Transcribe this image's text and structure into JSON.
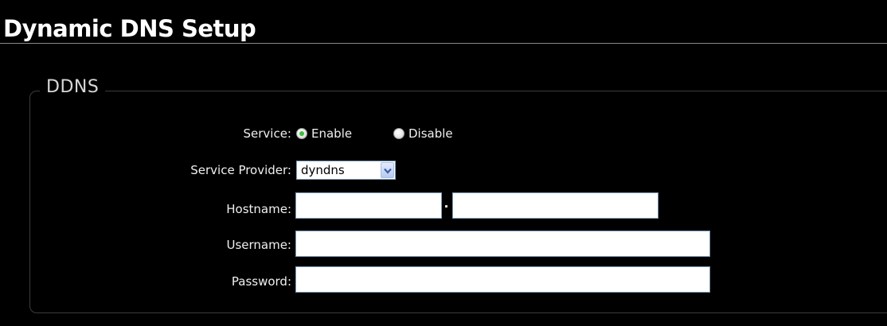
{
  "page": {
    "title": "Dynamic DNS Setup"
  },
  "ddns": {
    "legend": "DDNS",
    "service": {
      "label": "Service:",
      "options": [
        {
          "label": "Enable",
          "selected": true
        },
        {
          "label": "Disable",
          "selected": false
        }
      ]
    },
    "provider": {
      "label": "Service Provider:",
      "value": "dyndns"
    },
    "hostname": {
      "label": "Hostname:",
      "value_part1": "",
      "value_part2": ""
    },
    "username": {
      "label": "Username:",
      "value": ""
    },
    "password": {
      "label": "Password:",
      "value": ""
    }
  },
  "colors": {
    "background": "#000000",
    "text": "#f0f0f0",
    "radio_selected": "#3cbf3c",
    "input_border": "#7f9db9"
  },
  "icons": {
    "dropdown": "chevron-down-icon",
    "radio_selected": "radio-selected-icon",
    "radio_unselected": "radio-unselected-icon"
  }
}
